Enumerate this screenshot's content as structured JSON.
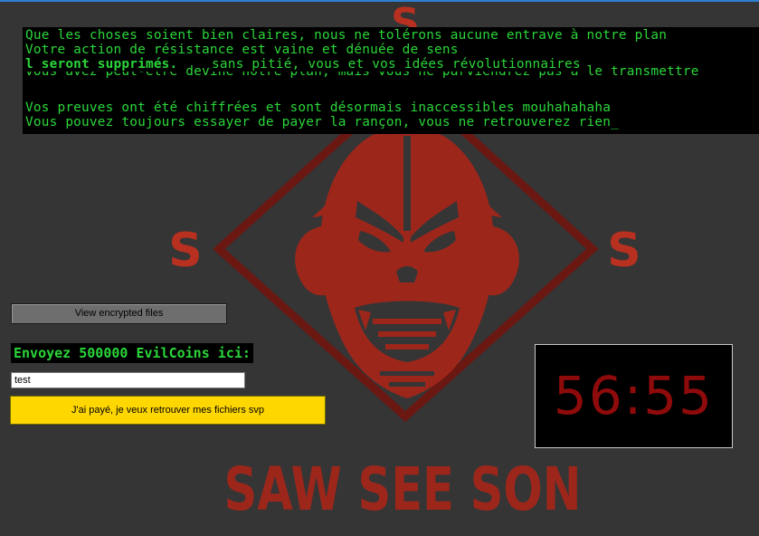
{
  "message": {
    "lines": [
      "Que les choses soient bien claires, nous ne tolérons aucune entrave à notre plan",
      "Votre action de résistance est vaine et dénuée de sens",
      "vous avez peut-être deviné notre plan, mais vous ne parviendrez pas à le transmettre",
      "Vos preuves ont été chiffrées et sont désormais inaccessibles mouhahahaha",
      "Vous pouvez toujours essayer de payer la rançon, vous ne retrouverez rien_"
    ],
    "overlay_bold": "l seront supprimés.",
    "overlay_rest": "sans pitié, vous et vos idées révolutionnaires"
  },
  "buttons": {
    "view_encrypted": "View encrypted files",
    "paid": "J'ai payé, je veux retrouver mes fichiers svp"
  },
  "payment": {
    "label": "Envoyez 500000 EvilCoins ici:",
    "input_value": "test"
  },
  "timer": {
    "value": "56:55"
  },
  "artwork": {
    "logo_text": "SAW SEE SON",
    "letter_s": "S"
  },
  "colors": {
    "background": "#353535",
    "terminal_text": "#2bd63a",
    "art_red": "#9d261b",
    "timer_red": "#8f0b0b",
    "pay_button": "#ffd700"
  }
}
